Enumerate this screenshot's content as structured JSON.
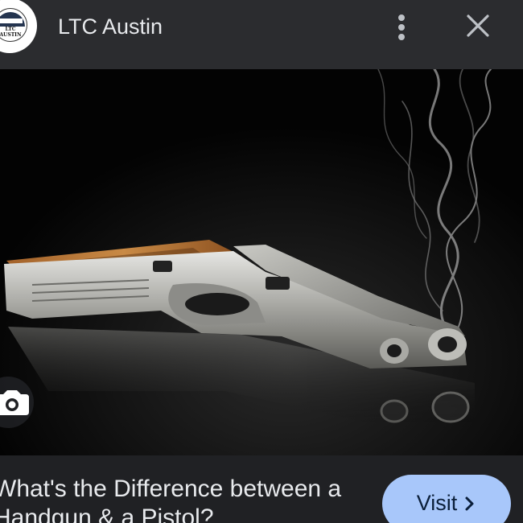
{
  "header": {
    "site_title": "LTC Austin",
    "logo_text": "LTC AUSTIN"
  },
  "hero": {
    "image_subject": "silver handgun with wood grip and smoke from barrel on black reflective surface"
  },
  "result": {
    "caption": "What's the Difference between a Handgun & a Pistol?",
    "visit_label": "Visit"
  },
  "colors": {
    "header_bg": "#2b2c2f",
    "page_bg": "#202124",
    "visit_bg": "#a8c7fa",
    "text": "#e8eaed"
  },
  "icons": [
    "more-vert-icon",
    "close-icon",
    "google-lens-icon",
    "chevron-right-icon"
  ]
}
